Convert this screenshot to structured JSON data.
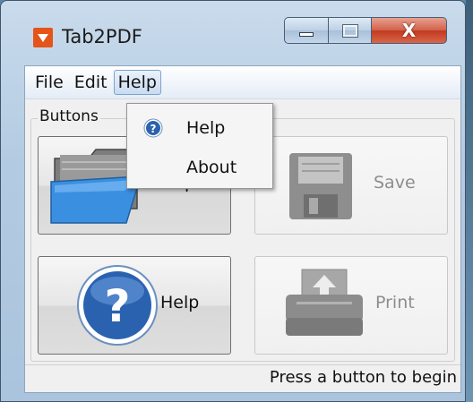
{
  "window": {
    "title": "Tab2PDF",
    "close_glyph": "X"
  },
  "menubar": {
    "items": [
      {
        "label": "File"
      },
      {
        "label": "Edit"
      },
      {
        "label": "Help"
      }
    ]
  },
  "help_menu": {
    "items": [
      {
        "label": "Help",
        "icon": "help-circle-icon"
      },
      {
        "label": "About"
      }
    ]
  },
  "groupbox": {
    "label": "Buttons"
  },
  "buttons": {
    "open": {
      "label": "Open",
      "icon": "folder-icon",
      "enabled": true
    },
    "save": {
      "label": "Save",
      "icon": "floppy-disk-icon",
      "enabled": false
    },
    "help": {
      "label": "Help",
      "icon": "help-circle-icon",
      "enabled": true
    },
    "print": {
      "label": "Print",
      "icon": "printer-icon",
      "enabled": false
    }
  },
  "status": {
    "text": "Press a button to begin"
  },
  "colors": {
    "accent": "#e5541b",
    "help_blue": "#2a62b0",
    "close_red": "#c13a1f"
  }
}
